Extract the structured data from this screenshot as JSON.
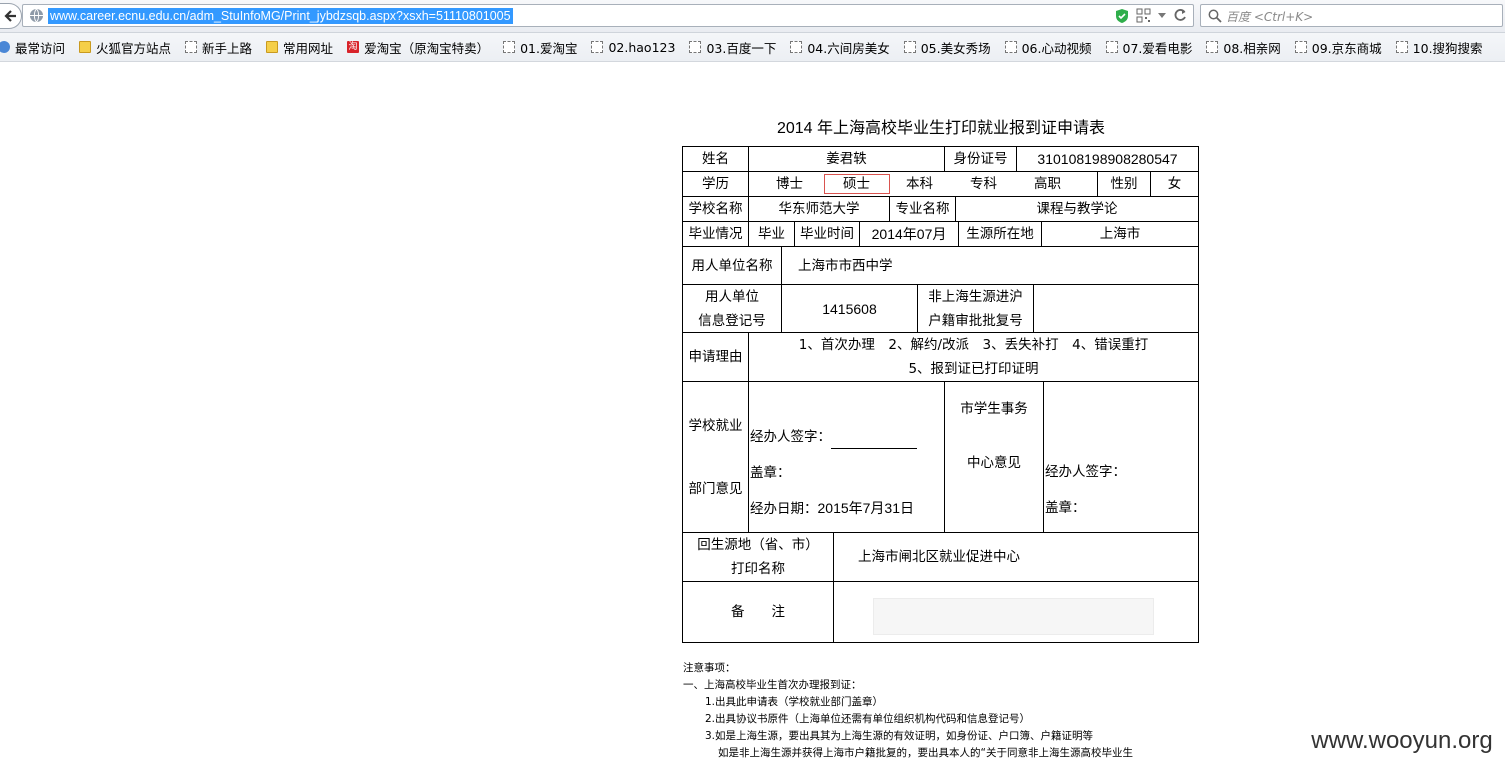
{
  "browser": {
    "url": "www.career.ecnu.edu.cn/adm_StuInfoMG/Print_jybdzsqb.aspx?xsxh=51110801005",
    "search_placeholder": "百度 <Ctrl+K>",
    "bookmarks": [
      {
        "label": "最常访问",
        "icon": "frequent-icon"
      },
      {
        "label": "火狐官方站点",
        "icon": "folder-icon"
      },
      {
        "label": "新手上路",
        "icon": "page-icon"
      },
      {
        "label": "常用网址",
        "icon": "folder-icon"
      },
      {
        "label": "爱淘宝（原淘宝特卖）",
        "icon": "taobao-icon"
      },
      {
        "label": "01.爱淘宝",
        "icon": "page-icon"
      },
      {
        "label": "02.hao123",
        "icon": "page-icon"
      },
      {
        "label": "03.百度一下",
        "icon": "page-icon"
      },
      {
        "label": "04.六间房美女",
        "icon": "page-icon"
      },
      {
        "label": "05.美女秀场",
        "icon": "page-icon"
      },
      {
        "label": "06.心动视频",
        "icon": "page-icon"
      },
      {
        "label": "07.爱看电影",
        "icon": "page-icon"
      },
      {
        "label": "08.相亲网",
        "icon": "page-icon"
      },
      {
        "label": "09.京东商城",
        "icon": "page-icon"
      },
      {
        "label": "10.搜狗搜索",
        "icon": "page-icon"
      }
    ]
  },
  "form": {
    "title": "2014 年上海高校毕业生打印就业报到证申请表",
    "name_label": "姓名",
    "name_value": "姜君轶",
    "id_label": "身份证号",
    "id_value": "310108198908280547",
    "education_label": "学历",
    "degree_options": [
      "博士",
      "硕士",
      "本科",
      "专科",
      "高职"
    ],
    "selected_degree": "硕士",
    "gender_label": "性别",
    "gender_value": "女",
    "school_label": "学校名称",
    "school_value": "华东师范大学",
    "major_label": "专业名称",
    "major_value": "课程与教学论",
    "grad_status_label": "毕业情况",
    "grad_status_value": "毕业",
    "grad_time_label": "毕业时间",
    "grad_time_value": "2014年07月",
    "origin_label": "生源所在地",
    "origin_value": "上海市",
    "employer_label": "用人单位名称",
    "employer_value": "上海市市西中学",
    "employer_reg_label_1": "用人单位",
    "employer_reg_label_2": "信息登记号",
    "employer_reg_value": "1415608",
    "approval_label_1": "非上海生源进沪",
    "approval_label_2": "户籍审批批复号",
    "approval_value": "",
    "reason_label": "申请理由",
    "reason_line_1": "1、首次办理　2、解约/改派　3、丢失补打　4、错误重打",
    "reason_line_2": "5、报到证已打印证明",
    "school_dept_label_1": "学校就业",
    "school_dept_label_2": "部门意见",
    "handler_sign_label": "经办人签字：",
    "seal_label": "盖章：",
    "handle_date_label": "经办日期：",
    "handle_date_value": "2015年7月31日",
    "city_center_label_1": "市学生事务",
    "city_center_label_2": "中心意见",
    "city_handler_sign_label": "经办人签字：",
    "city_seal_label": "盖章：",
    "print_name_label_1": "回生源地（省、市）",
    "print_name_label_2": "打印名称",
    "print_name_value": "上海市闸北区就业促进中心",
    "remarks_label": "备　　注",
    "remarks_value": ""
  },
  "notes": {
    "heading": "注意事项：",
    "section_1": "一、上海高校毕业生首次办理报到证：",
    "items": [
      "1.出具此申请表（学校就业部门盖章）",
      "2.出具协议书原件（上海单位还需有单位组织机构代码和信息登记号）",
      "3.如是上海生源，要出具其为上海生源的有效证明，如身份证、户口簿、户籍证明等",
      "如是非上海生源并获得上海市户籍批复的，要出具本人的“关于同意非上海生源高校毕业生"
    ]
  },
  "watermark": "www.wooyun.org"
}
